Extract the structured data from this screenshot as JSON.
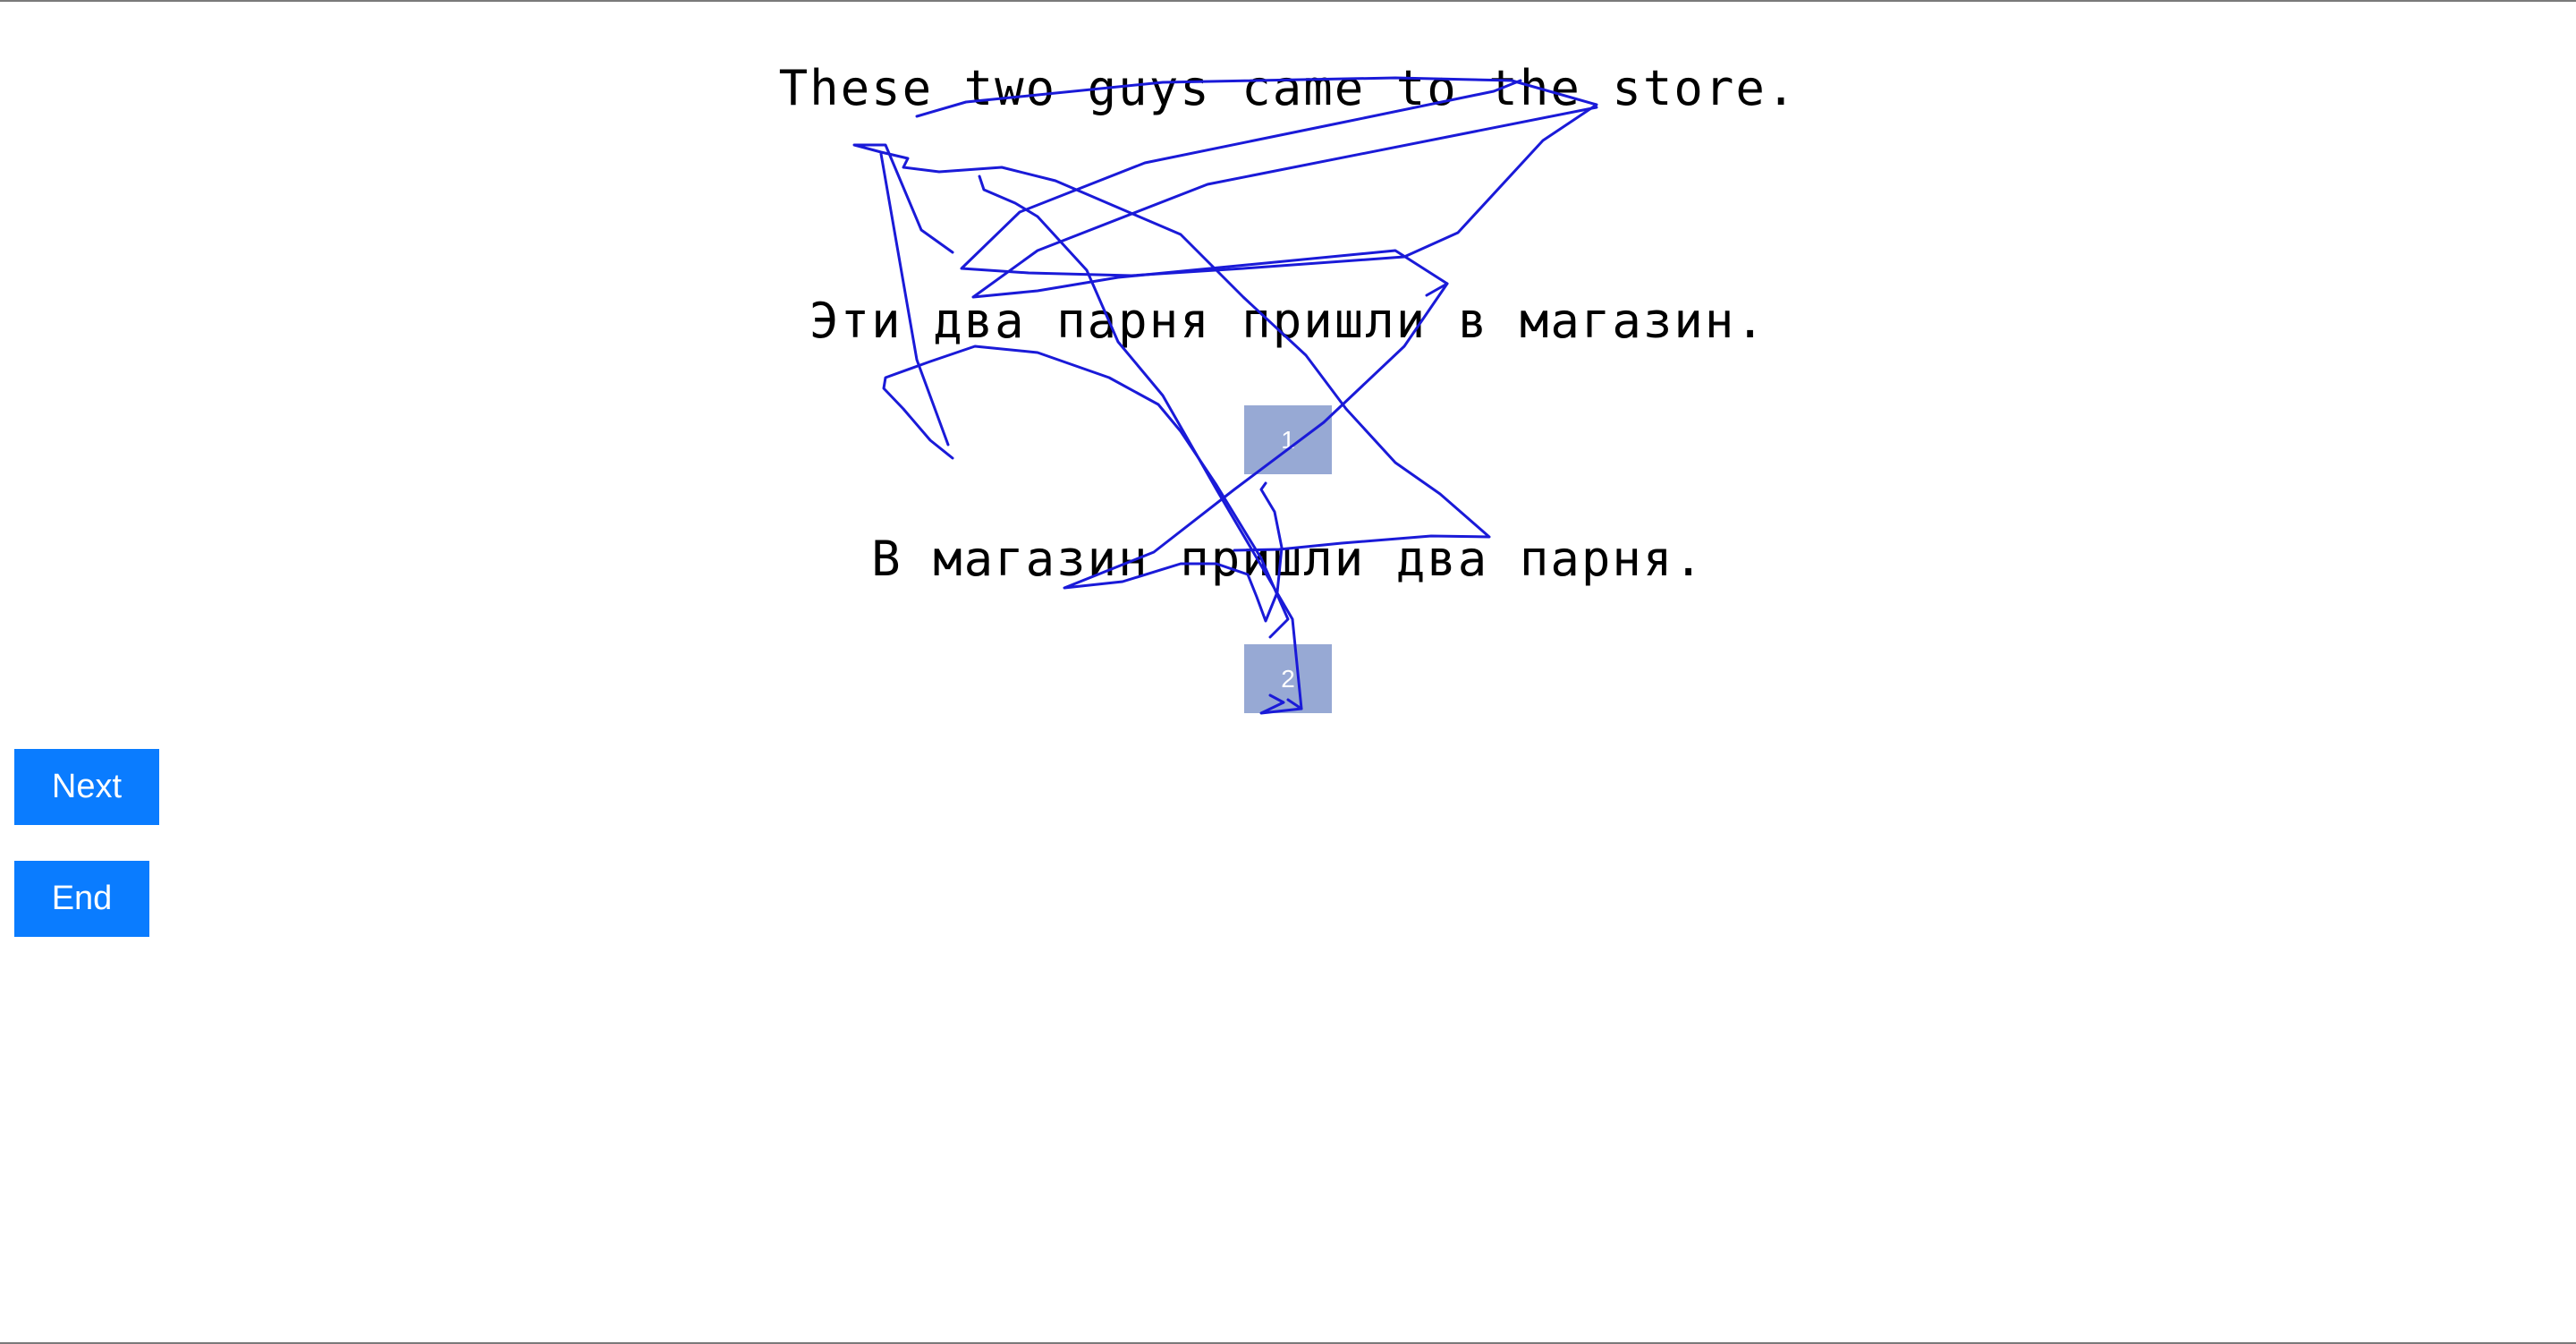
{
  "sentences": {
    "source": "These two guys came to the store.",
    "translation_1": "Эти два парня пришли в магазин.",
    "translation_2": "В магазин пришли два парня."
  },
  "options": [
    {
      "label": "1"
    },
    {
      "label": "2"
    }
  ],
  "buttons": {
    "next_label": "Next",
    "end_label": "End"
  },
  "colors": {
    "button": "#0a7cff",
    "option_box": "#97a9d4",
    "scribble": "#1a1ad8"
  }
}
